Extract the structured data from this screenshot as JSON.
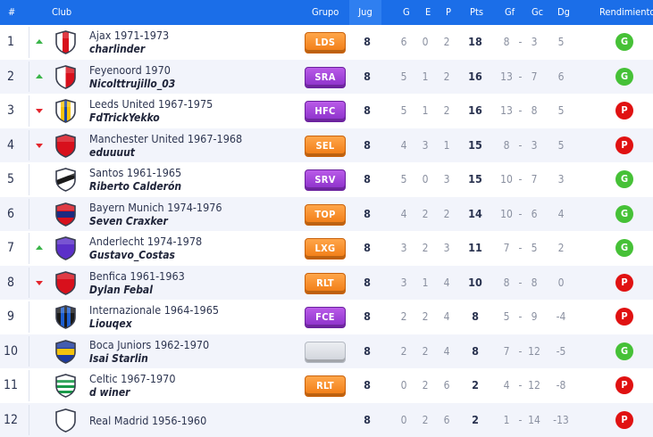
{
  "header": {
    "pos": "#",
    "club": "Club",
    "group": "Grupo",
    "played": "Jug",
    "won": "G",
    "drawn": "E",
    "lost": "P",
    "points": "Pts",
    "gf": "Gf",
    "gc": "Gc",
    "dg": "Dg",
    "performance": "Rendimiento"
  },
  "rows": [
    {
      "pos": "1",
      "trend": "up",
      "club": "Ajax 1971-1973",
      "owner": "charlinder",
      "group": "LDS",
      "group_color": "orange",
      "shield": "ajax-shield-icon",
      "played": "8",
      "won": "6",
      "drawn": "0",
      "lost": "2",
      "points": "18",
      "gf": "8",
      "gc": "3",
      "dg": "5",
      "perf": "G"
    },
    {
      "pos": "2",
      "trend": "up",
      "club": "Feyenoord 1970",
      "owner": "Nicolttrujillo_03",
      "group": "SRA",
      "group_color": "purple",
      "shield": "feyenoord-shield-icon",
      "played": "8",
      "won": "5",
      "drawn": "1",
      "lost": "2",
      "points": "16",
      "gf": "13",
      "gc": "7",
      "dg": "6",
      "perf": "G"
    },
    {
      "pos": "3",
      "trend": "down",
      "club": "Leeds United 1967-1975",
      "owner": "FdTrickYekko",
      "group": "HFC",
      "group_color": "purple",
      "shield": "leeds-shield-icon",
      "played": "8",
      "won": "5",
      "drawn": "1",
      "lost": "2",
      "points": "16",
      "gf": "13",
      "gc": "8",
      "dg": "5",
      "perf": "P"
    },
    {
      "pos": "4",
      "trend": "down",
      "club": "Manchester United 1967-1968",
      "owner": "eduuuut",
      "group": "SEL",
      "group_color": "orange",
      "shield": "manchester-united-shield-icon",
      "played": "8",
      "won": "4",
      "drawn": "3",
      "lost": "1",
      "points": "15",
      "gf": "8",
      "gc": "3",
      "dg": "5",
      "perf": "P"
    },
    {
      "pos": "5",
      "trend": "none",
      "club": "Santos 1961-1965",
      "owner": "Riberto Calderón",
      "group": "SRV",
      "group_color": "purple",
      "shield": "santos-shield-icon",
      "played": "8",
      "won": "5",
      "drawn": "0",
      "lost": "3",
      "points": "15",
      "gf": "10",
      "gc": "7",
      "dg": "3",
      "perf": "G"
    },
    {
      "pos": "6",
      "trend": "none",
      "club": "Bayern Munich 1974-1976",
      "owner": "Seven Craxker",
      "group": "TOP",
      "group_color": "orange",
      "shield": "bayern-munich-shield-icon",
      "played": "8",
      "won": "4",
      "drawn": "2",
      "lost": "2",
      "points": "14",
      "gf": "10",
      "gc": "6",
      "dg": "4",
      "perf": "G"
    },
    {
      "pos": "7",
      "trend": "up",
      "club": "Anderlecht 1974-1978",
      "owner": "Gustavo_Costas",
      "group": "LXG",
      "group_color": "orange",
      "shield": "anderlecht-shield-icon",
      "played": "8",
      "won": "3",
      "drawn": "2",
      "lost": "3",
      "points": "11",
      "gf": "7",
      "gc": "5",
      "dg": "2",
      "perf": "G"
    },
    {
      "pos": "8",
      "trend": "down",
      "club": "Benfica 1961-1963",
      "owner": "Dylan Febal",
      "group": "RLT",
      "group_color": "orange",
      "shield": "benfica-shield-icon",
      "played": "8",
      "won": "3",
      "drawn": "1",
      "lost": "4",
      "points": "10",
      "gf": "8",
      "gc": "8",
      "dg": "0",
      "perf": "P"
    },
    {
      "pos": "9",
      "trend": "none",
      "club": "Internazionale 1964-1965",
      "owner": "Liouqex",
      "group": "FCE",
      "group_color": "purple",
      "shield": "internazionale-shield-icon",
      "played": "8",
      "won": "2",
      "drawn": "2",
      "lost": "4",
      "points": "8",
      "gf": "5",
      "gc": "9",
      "dg": "-4",
      "perf": "P"
    },
    {
      "pos": "10",
      "trend": "none",
      "club": "Boca Juniors 1962-1970",
      "owner": "Isai Starlin",
      "group": "",
      "group_color": "gray",
      "shield": "boca-juniors-shield-icon",
      "played": "8",
      "won": "2",
      "drawn": "2",
      "lost": "4",
      "points": "8",
      "gf": "7",
      "gc": "12",
      "dg": "-5",
      "perf": "G"
    },
    {
      "pos": "11",
      "trend": "none",
      "club": "Celtic 1967-1970",
      "owner": "d winer",
      "group": "RLT",
      "group_color": "orange",
      "shield": "celtic-shield-icon",
      "played": "8",
      "won": "0",
      "drawn": "2",
      "lost": "6",
      "points": "2",
      "gf": "4",
      "gc": "12",
      "dg": "-8",
      "perf": "P"
    },
    {
      "pos": "12",
      "trend": "none",
      "club": "Real Madrid 1956-1960",
      "owner": "",
      "group": "",
      "group_color": "none",
      "shield": "real-madrid-shield-icon",
      "played": "8",
      "won": "0",
      "drawn": "2",
      "lost": "6",
      "points": "2",
      "gf": "1",
      "gc": "14",
      "dg": "-13",
      "perf": "P"
    }
  ],
  "score_separator": "-",
  "colors": {
    "header_bg": "#1b6ee8",
    "win": "#46c137",
    "loss": "#e01212",
    "trend_up": "#3bb54a",
    "trend_down": "#e3262d"
  }
}
